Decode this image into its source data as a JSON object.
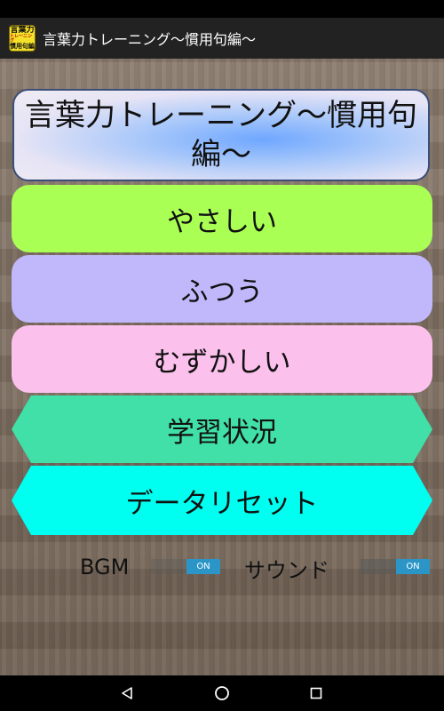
{
  "app": {
    "title": "言葉力トレーニング〜慣用句編〜",
    "icon_text": {
      "line1": "言葉力",
      "line2": "トレーニング",
      "line3": "慣用句編"
    }
  },
  "banner": {
    "title": "言葉力トレーニング〜慣用句編〜"
  },
  "menu": {
    "easy": "やさしい",
    "normal": "ふつう",
    "hard": "むずかしい",
    "study": "学習状況",
    "reset": "データリセット"
  },
  "settings": {
    "bgm_label": "BGM",
    "bgm_state": "ON",
    "sound_label": "サウンド",
    "sound_state": "ON"
  },
  "colors": {
    "easy": "#aaff55",
    "normal": "#c0b8fb",
    "hard": "#fbc0ec",
    "study": "#40e0a8",
    "reset": "#00fff0",
    "toggle_on": "#2a95c6"
  },
  "nav": {
    "icons": [
      "back-icon",
      "home-icon",
      "recent-apps-icon"
    ]
  }
}
